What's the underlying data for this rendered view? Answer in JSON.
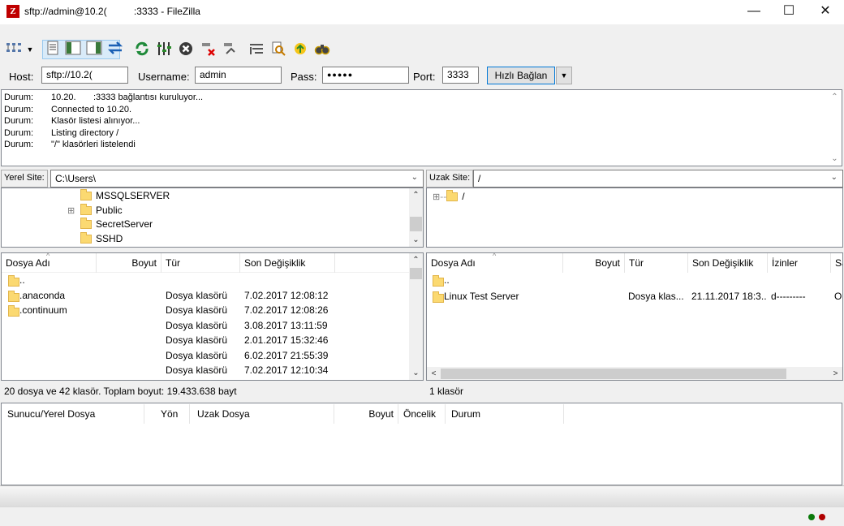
{
  "window": {
    "title": "sftp://admin@10.2(          :3333 - FileZilla",
    "app_icon_glyph": "Z",
    "minimize": "—",
    "maximize": "☐",
    "close": "✕"
  },
  "toolbar": {
    "icons": [
      "site-manager-icon",
      "dropdown-arrow",
      "message-log-toggle",
      "local-tree-toggle",
      "remote-tree-toggle",
      "transfer-queue-toggle",
      "refresh-icon",
      "process-queue-icon",
      "cancel-icon",
      "disconnect-icon",
      "reconnect-icon",
      "filter-icon",
      "compare-icon",
      "sync-browse-icon",
      "search-icon"
    ]
  },
  "quickconnect": {
    "host_label": "Host:",
    "host_value": "sftp://10.2(",
    "username_label": "Username:",
    "username_value": "admin",
    "pass_label": "Pass:",
    "pass_value": "●●●●●",
    "port_label": "Port:",
    "port_value": "3333",
    "connect_label": "Hızlı Bağlan",
    "dropdown": "▼"
  },
  "log": [
    {
      "key": "Durum:",
      "msg": "10.20.       :3333 bağlantısı kuruluyor..."
    },
    {
      "key": "Durum:",
      "msg": "Connected to 10.20."
    },
    {
      "key": "Durum:",
      "msg": "Klasör listesi alınıyor..."
    },
    {
      "key": "Durum:",
      "msg": "Listing directory /"
    },
    {
      "key": "Durum:",
      "msg": "\"/\" klasörleri listelendi"
    }
  ],
  "local": {
    "site_label": "Yerel Site:",
    "path": "C:\\Users\\",
    "tree": [
      {
        "name": "MSSQLSERVER",
        "expander": ""
      },
      {
        "name": "Public",
        "expander": "⊞"
      },
      {
        "name": "SecretServer",
        "expander": ""
      },
      {
        "name": "SSHD",
        "expander": ""
      }
    ],
    "columns": [
      "Dosya Adı",
      "Boyut",
      "Tür",
      "Son Değişiklik"
    ],
    "files": [
      {
        "name": "..",
        "size": "",
        "type": "",
        "modified": ""
      },
      {
        "name": ".anaconda",
        "size": "",
        "type": "Dosya klasörü",
        "modified": "7.02.2017 12:08:12"
      },
      {
        "name": ".continuum",
        "size": "",
        "type": "Dosya klasörü",
        "modified": "7.02.2017 12:08:26"
      },
      {
        "name": "",
        "size": "",
        "type": "Dosya klasörü",
        "modified": "3.08.2017 13:11:59"
      },
      {
        "name": "",
        "size": "",
        "type": "Dosya klasörü",
        "modified": "2.01.2017 15:32:46"
      },
      {
        "name": "",
        "size": "",
        "type": "Dosya klasörü",
        "modified": "6.02.2017 21:55:39"
      },
      {
        "name": "",
        "size": "",
        "type": "Dosya klasörü",
        "modified": "7.02.2017 12:10:34"
      }
    ],
    "status": "20 dosya ve 42 klasör. Toplam boyut: 19.433.638 bayt"
  },
  "remote": {
    "site_label": "Uzak Site:",
    "path": "/",
    "tree": [
      {
        "name": "/",
        "expander": "⊞"
      }
    ],
    "columns": [
      "Dosya Adı",
      "Boyut",
      "Tür",
      "Son Değişiklik",
      "İzinler",
      "Sa"
    ],
    "files": [
      {
        "name": "..",
        "size": "",
        "type": "",
        "modified": "",
        "perms": "",
        "owner": ""
      },
      {
        "name": "Linux Test Server",
        "size": "",
        "type": "Dosya klas...",
        "modified": "21.11.2017 18:3...",
        "perms": "d---------",
        "owner": "O"
      }
    ],
    "status": "1 klasör"
  },
  "queue": {
    "columns": [
      "Sunucu/Yerel Dosya",
      "Yön",
      "Uzak Dosya",
      "Boyut",
      "Öncelik",
      "Durum"
    ]
  },
  "statusbar": {
    "led_colors": [
      "#0b7a0b",
      "#b00000"
    ]
  }
}
